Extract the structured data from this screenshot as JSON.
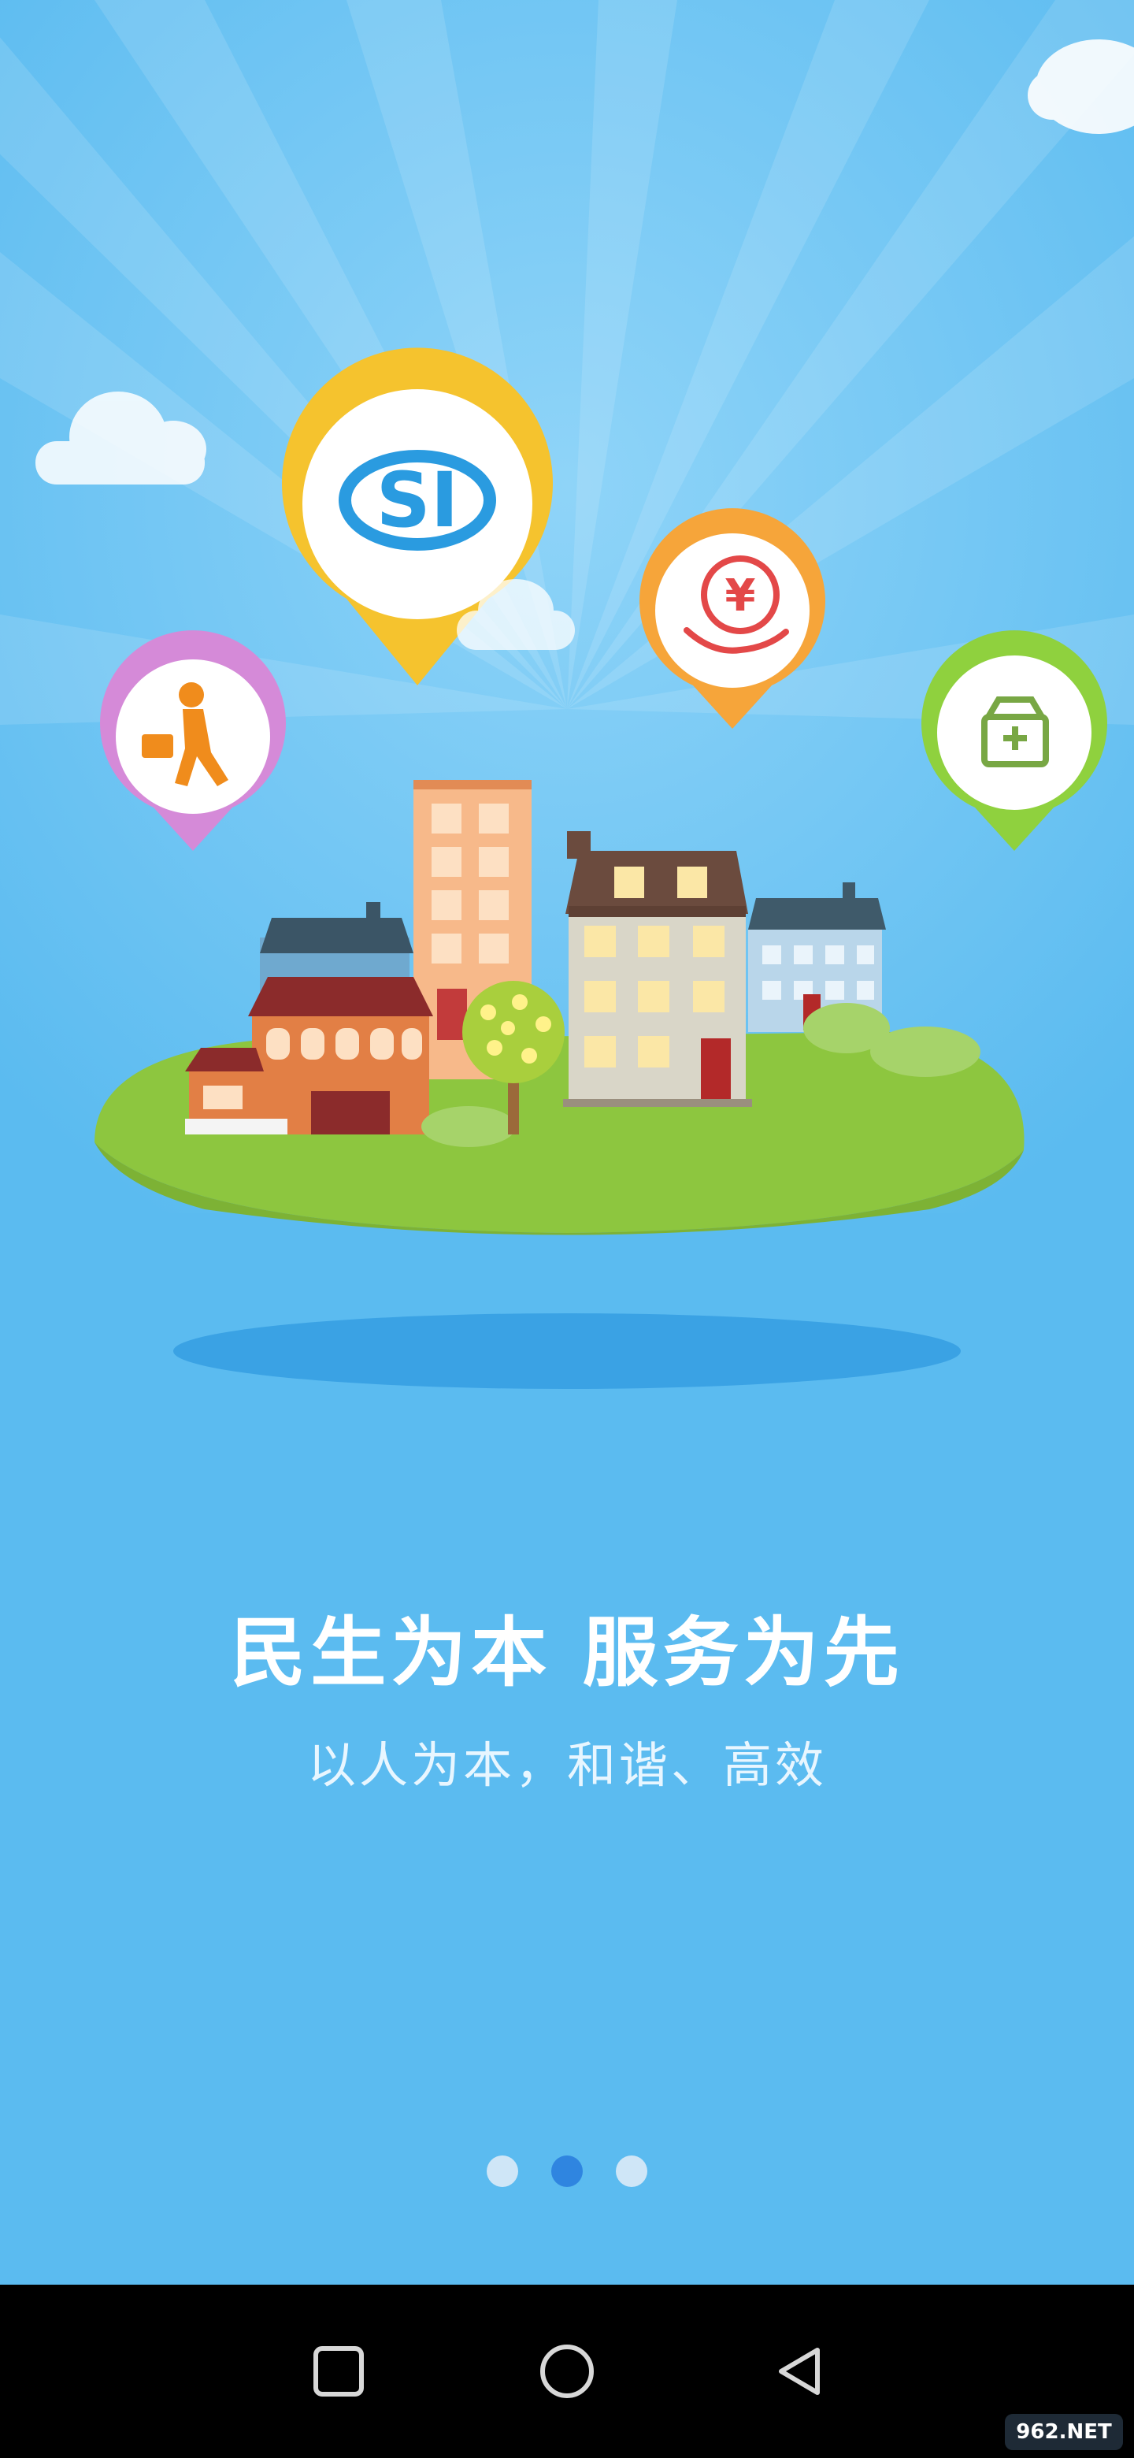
{
  "slogan": {
    "headline": "民生为本  服务为先",
    "subline": "以人为本，和谐、高效"
  },
  "pager": {
    "total": 3,
    "active_index": 1
  },
  "illustration": {
    "bubble_logo_text": "SI",
    "yen_symbol": "¥"
  },
  "navbar": {
    "recents_icon": "square-recents-icon",
    "home_icon": "circle-home-icon",
    "back_icon": "triangle-back-icon"
  },
  "watermark": "962.NET",
  "colors": {
    "sky": "#5bbbf0",
    "island": "#8dc63f",
    "bubble_yellow": "#f5c32e",
    "bubble_purple": "#d58ad8",
    "bubble_orange": "#f6a53a",
    "bubble_green": "#8fd13e",
    "active_dot": "#2f85e0"
  }
}
